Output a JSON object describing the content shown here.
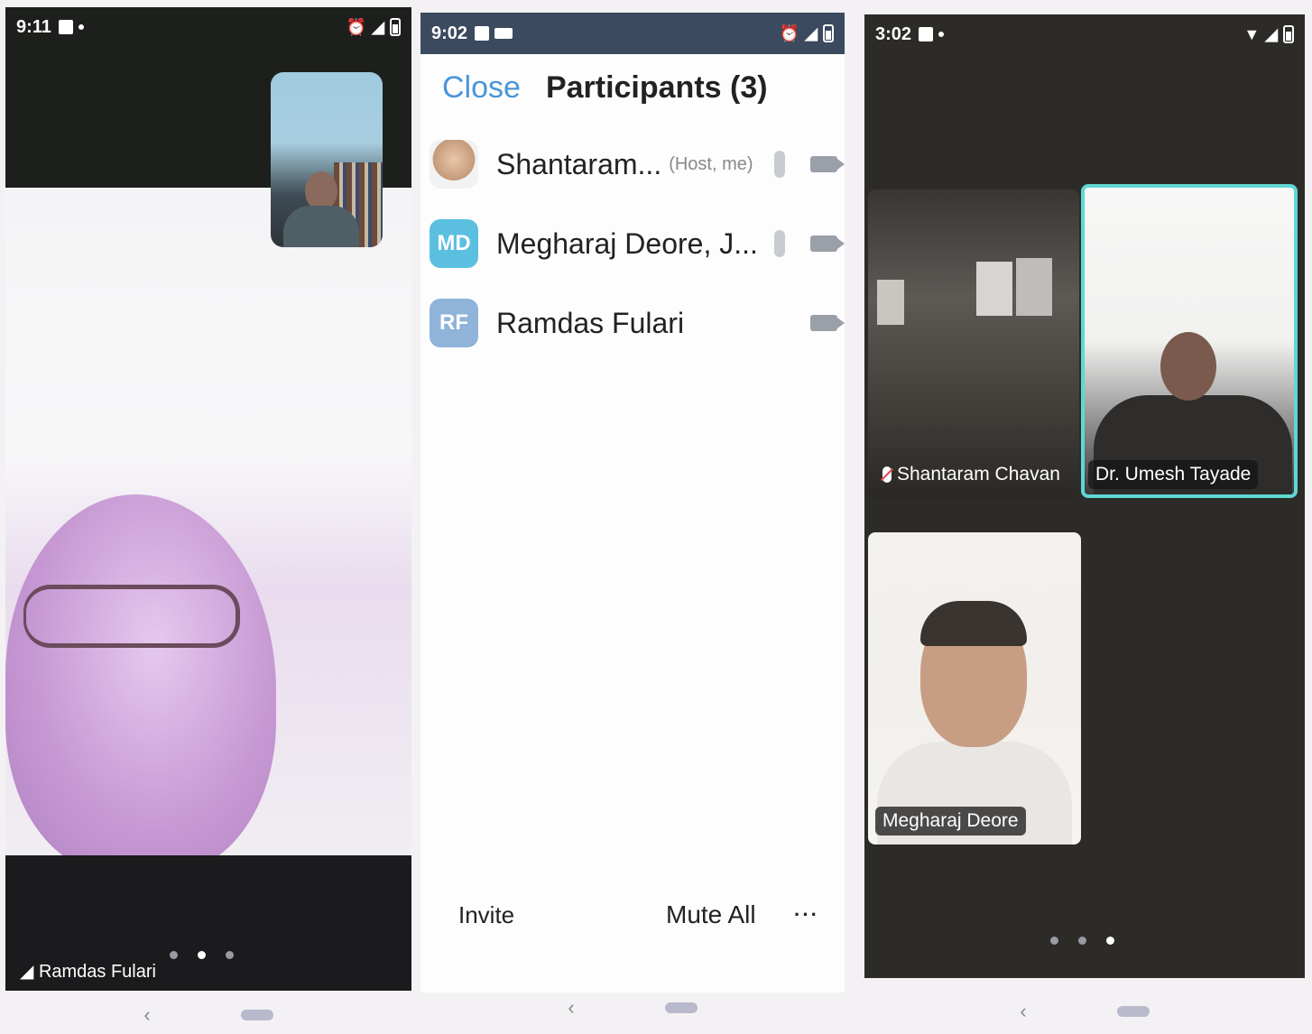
{
  "phone1": {
    "status_time": "9:11",
    "active_speaker": "Ramdas Fulari",
    "page_dots": [
      false,
      true,
      false
    ]
  },
  "phone2": {
    "status_time": "9:02",
    "header": {
      "close_label": "Close",
      "title": "Participants (3)"
    },
    "participants": [
      {
        "name": "Shantaram...",
        "role": "(Host, me)",
        "avatar_initials": "",
        "avatar_color": "",
        "has_mic": true,
        "has_cam": true
      },
      {
        "name": "Megharaj Deore, J...",
        "role": "",
        "avatar_initials": "MD",
        "avatar_color": "#5bc0e0",
        "has_mic": true,
        "has_cam": true
      },
      {
        "name": "Ramdas Fulari",
        "role": "",
        "avatar_initials": "RF",
        "avatar_color": "#8fb3d9",
        "has_mic": false,
        "has_cam": true
      }
    ],
    "footer": {
      "invite_label": "Invite",
      "mute_all_label": "Mute All",
      "more_label": "···"
    }
  },
  "phone3": {
    "status_time": "3:02",
    "tiles": [
      {
        "name": "Shantaram Chavan",
        "muted": true,
        "active": false
      },
      {
        "name": "Dr. Umesh Tayade",
        "muted": false,
        "active": true
      },
      {
        "name": "Megharaj Deore",
        "muted": false,
        "active": false
      }
    ],
    "page_dots": [
      false,
      false,
      true
    ]
  },
  "nav": {
    "back_symbol": "‹"
  },
  "colors": {
    "zoom_blue": "#4a96d8",
    "active_speaker_border": "#5fd7d3",
    "dark_background": "#2c2b28"
  }
}
